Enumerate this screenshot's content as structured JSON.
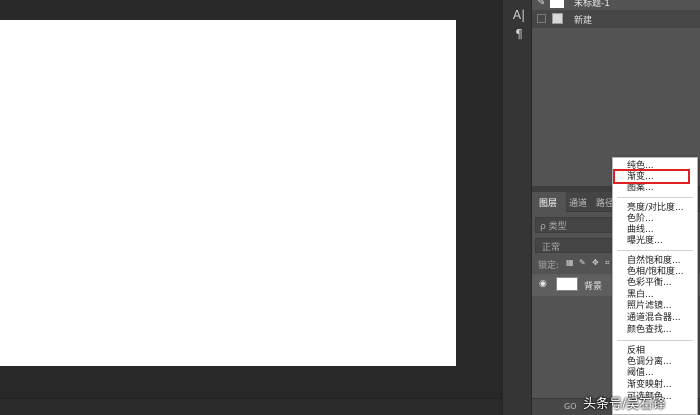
{
  "history": {
    "snapshot_title": "未标题-1",
    "items": [
      {
        "label": "新建"
      }
    ]
  },
  "layers_panel": {
    "tabs": [
      "图层",
      "通道",
      "路径"
    ],
    "filter_placeholder": "ρ 类型",
    "blend_mode": "正常",
    "lock_label": "锁定:",
    "layers": [
      {
        "name": "背景"
      }
    ]
  },
  "context_menu": {
    "groups": [
      [
        "纯色...",
        "渐变...",
        "图案..."
      ],
      [
        "亮度/对比度...",
        "色阶...",
        "曲线...",
        "曝光度..."
      ],
      [
        "自然饱和度...",
        "色相/饱和度...",
        "色彩平衡...",
        "黑白...",
        "照片滤镜...",
        "通道混合器...",
        "颜色查找..."
      ],
      [
        "反相",
        "色调分离...",
        "阈值...",
        "渐变映射...",
        "可选颜色..."
      ]
    ],
    "highlighted_item": "渐变..."
  },
  "toolstrip": {
    "icons": [
      "type-character-icon",
      "paragraph-icon"
    ],
    "char_glyph": "A|",
    "para_glyph": "¶"
  },
  "footer": {
    "link_glyph": "GO"
  },
  "watermark": "头条号/吴石锋",
  "colors": {
    "highlight": "#e02020",
    "panel_bg": "#535353",
    "workspace_bg": "#282828",
    "canvas": "#ffffff"
  }
}
